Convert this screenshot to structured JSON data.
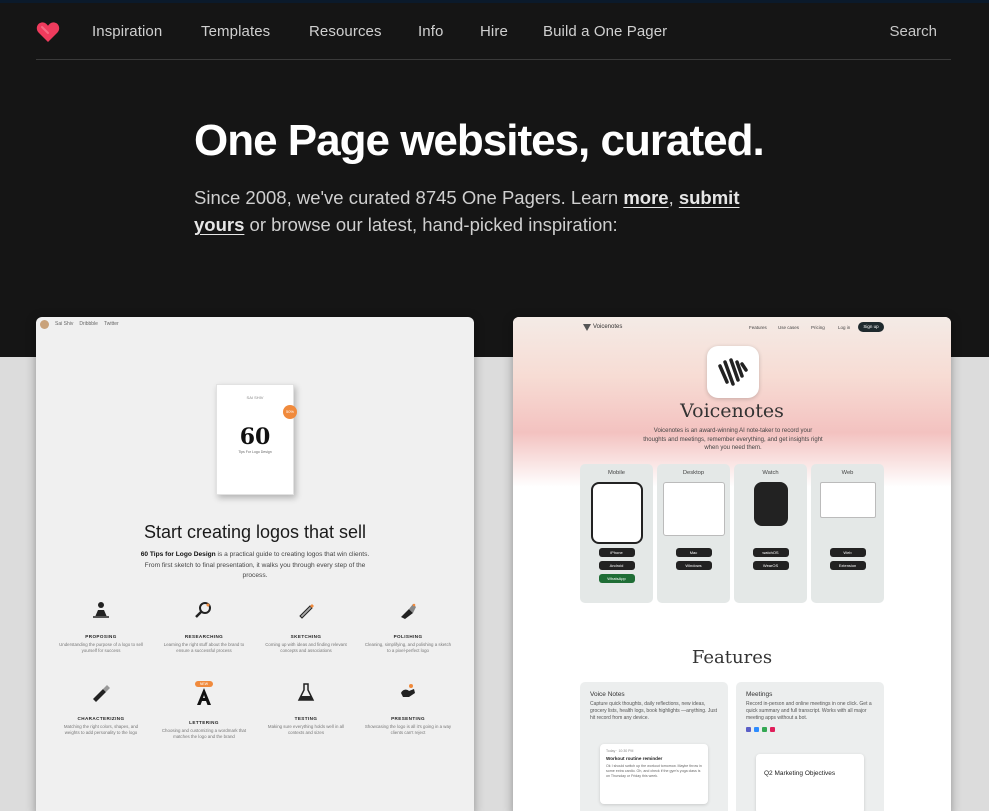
{
  "nav": {
    "links": [
      "Inspiration",
      "Templates",
      "Resources",
      "Info",
      "Hire",
      "Build a One Pager"
    ],
    "search": "Search"
  },
  "hero": {
    "title": "One Page websites, curated.",
    "sub_before": "Since 2008, we've curated 8745 One Pagers. Learn ",
    "link_more": "more",
    "sub_comma": ", ",
    "link_submit": "submit yours",
    "sub_after": " or browse our latest, hand-picked inspiration:"
  },
  "card_left": {
    "top_name": "Sai Shiv",
    "top_links": [
      "Dribbble",
      "Twitter"
    ],
    "book_top": "SAI SHIV",
    "book_number": "60",
    "book_sub": "Tips For Logo Design",
    "badge": "50%",
    "headline": "Start creating logos that sell",
    "desc_bold": "60 Tips for Logo Design",
    "desc_rest": " is a practical guide to creating logos that win clients. From first sketch to final presentation, it walks you through every step of the process.",
    "items": [
      {
        "title": "PROPOSING",
        "text": "Understanding the purpose of a logo to sell yourself for success"
      },
      {
        "title": "RESEARCHING",
        "text": "Learning the right stuff about the brand to ensure a successful process"
      },
      {
        "title": "SKETCHING",
        "text": "Coming up with ideas and finding relevant concepts and associations"
      },
      {
        "title": "POLISHING",
        "text": "Cleaning, simplifying, and polishing a sketch to a pixel-perfect logo"
      },
      {
        "title": "CHARACTERIZING",
        "text": "Matching the right colors, shapes, and weights to add personality to the logo"
      },
      {
        "title": "LETTERING",
        "text": "Choosing and customizing a wordmark that matches the logo and the brand"
      },
      {
        "title": "TESTING",
        "text": "Making sure everything holds well in all contexts and sizes"
      },
      {
        "title": "PRESENTING",
        "text": "Showcasing the logo is all it's going in a way clients can't reject"
      }
    ],
    "lettering_badge": "NEW"
  },
  "card_right": {
    "brand": "Voicenotes",
    "nav_links": [
      "Features",
      "Use cases",
      "Pricing",
      "Log in"
    ],
    "signup": "Sign up",
    "app_name": "Voicenotes",
    "desc": "Voicenotes is an award-winning AI note-taker to record your thoughts and meetings, remember everything, and get insights right when you need them.",
    "platforms": [
      {
        "label": "Mobile",
        "buttons": [
          "iPhone",
          "Android",
          "WhatsApp"
        ]
      },
      {
        "label": "Desktop",
        "buttons": [
          "Mac",
          "Windows"
        ]
      },
      {
        "label": "Watch",
        "buttons": [
          "watchOS",
          "WearOS"
        ]
      },
      {
        "label": "Web",
        "buttons": [
          "Web",
          "Extension"
        ]
      }
    ],
    "features_title": "Features",
    "voice_notes": {
      "title": "Voice Notes",
      "text": "Capture quick thoughts, daily reflections, new ideas, grocery lists, health logs, book highlights —anything. Just hit record from any device.",
      "card_date": "Today · 10:30 PM",
      "card_title": "Workout routine reminder",
      "card_text": "Ok I should switch up the workout tomorrow. Maybe throw in some extra cardio. Oh, and check if the gym's yoga class is on Thursday or Friday this week."
    },
    "meetings": {
      "title": "Meetings",
      "text": "Record in-person and online meetings in one click. Get a quick summary and full transcript. Works with all major meeting apps without a bot.",
      "card_title": "Q2 Marketing Objectives"
    }
  },
  "colors": {
    "hero_bg": "#151515",
    "page_bg": "#dcdcdc",
    "logo_heart": "#ef3b5d"
  }
}
